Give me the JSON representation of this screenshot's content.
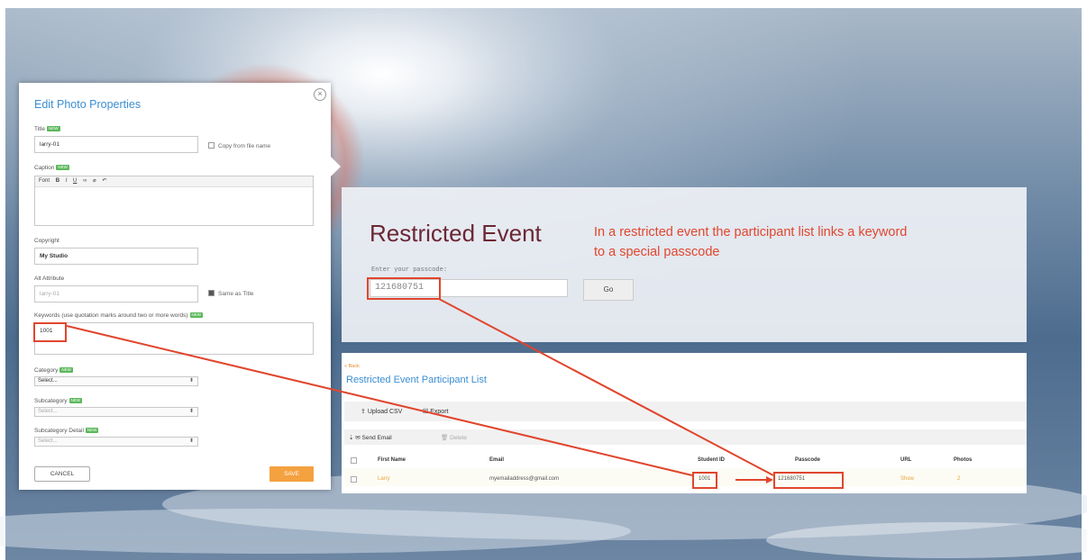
{
  "edit_panel": {
    "title": "Edit Photo Properties",
    "close_icon": "close-icon",
    "new_badge": "NEW",
    "title_label": "Title",
    "title_value": "larry-01",
    "copy_from_file_label": "Copy from file name",
    "caption_label": "Caption",
    "editor_toolbar": {
      "font": "Font",
      "bold": "B",
      "italic": "I",
      "underline": "U",
      "link": "∞",
      "unlink": "⌀",
      "undo": "↶"
    },
    "copyright_label": "Copyright",
    "copyright_value": "My Studio",
    "alt_attribute_label": "Alt Attribute",
    "alt_attribute_value": "larry-01",
    "same_as_title_label": "Same as Title",
    "keywords_label": "Keywords (use quotation marks around two or more words)",
    "keywords_value": "1001",
    "category_label": "Category",
    "category_value": "Select...",
    "subcategory_label": "Subcategory",
    "subcategory_value": "Select...",
    "subcategory_detail_label": "Subcategory Detail",
    "subcategory_detail_value": "Select...",
    "cancel_label": "CANCEL",
    "save_label": "SAVE"
  },
  "restricted_event": {
    "title": "Restricted Event",
    "annotation_line1": "In a restricted event the participant list links a keyword",
    "annotation_line2": "to a special passcode",
    "passcode_label": "Enter your passcode:",
    "passcode_value": "121680751",
    "go_label": "Go"
  },
  "participant_list": {
    "back_label": "« Back",
    "title": "Restricted Event Participant List",
    "upload_csv_label": "Upload CSV",
    "export_label": "Export",
    "send_email_label": "Send Email",
    "delete_label": "Delete",
    "columns": [
      "First Name",
      "Email",
      "Student ID",
      "Passcode",
      "URL",
      "Photos"
    ],
    "rows": [
      {
        "first_name": "Larry",
        "email": "myemailaddress@gmail.com",
        "student_id": "1001",
        "passcode": "121680751",
        "url": "Show",
        "photos": "2"
      }
    ]
  },
  "colors": {
    "accent_blue": "#3a8ed2",
    "annotation_red": "#e0462e",
    "save_orange": "#f4a13f",
    "title_maroon": "#6b2734"
  }
}
